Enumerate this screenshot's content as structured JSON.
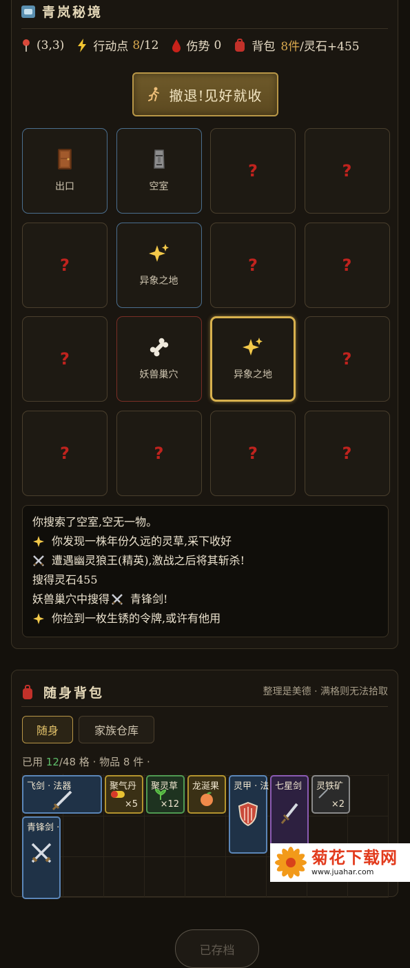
{
  "realm": {
    "title": "青岚秘境",
    "coords": "(3,3)",
    "action_label": "行动点",
    "action_value": "8",
    "action_max": "/12",
    "injury_label": "伤势",
    "injury_value": "0",
    "bag_label": "背包",
    "bag_items": "8件",
    "bag_stones": "/灵石+455",
    "retreat_button": "撤退!见好就收",
    "cells": [
      {
        "label": "出口",
        "type": "exit",
        "icon": "door-icon"
      },
      {
        "label": "空室",
        "type": "empty",
        "icon": "moai-icon"
      },
      {
        "label": "?",
        "type": "unknown",
        "icon": "question-mark-icon"
      },
      {
        "label": "?",
        "type": "unknown",
        "icon": "question-mark-icon"
      },
      {
        "label": "?",
        "type": "unknown",
        "icon": "question-mark-icon"
      },
      {
        "label": "异象之地",
        "type": "anomaly",
        "icon": "sparkles-icon"
      },
      {
        "label": "?",
        "type": "unknown",
        "icon": "question-mark-icon"
      },
      {
        "label": "?",
        "type": "unknown",
        "icon": "question-mark-icon"
      },
      {
        "label": "?",
        "type": "unknown",
        "icon": "question-mark-icon"
      },
      {
        "label": "妖兽巢穴",
        "type": "lair",
        "icon": "bone-icon"
      },
      {
        "label": "异象之地",
        "type": "current",
        "icon": "sparkles-icon"
      },
      {
        "label": "?",
        "type": "unknown",
        "icon": "question-mark-icon"
      },
      {
        "label": "?",
        "type": "unknown",
        "icon": "question-mark-icon"
      },
      {
        "label": "?",
        "type": "unknown",
        "icon": "question-mark-icon"
      },
      {
        "label": "?",
        "type": "unknown",
        "icon": "question-mark-icon"
      },
      {
        "label": "?",
        "type": "unknown",
        "icon": "question-mark-icon"
      }
    ],
    "log": [
      {
        "icon": "",
        "text": "你搜索了空室,空无一物。"
      },
      {
        "icon": "sparkles-icon",
        "text": "你发现一株年份久远的灵草,采下收好"
      },
      {
        "icon": "crossed-swords-icon",
        "text": "遭遇幽灵狼王(精英),激战之后将其斩杀!"
      },
      {
        "icon": "",
        "text": "搜得灵石455"
      },
      {
        "icon": "",
        "text": "妖兽巢穴中搜得",
        "icon_mid": "crossed-swords-icon",
        "text_after": "青锋剑!"
      },
      {
        "icon": "sparkles-icon",
        "text": "你捡到一枚生锈的令牌,或许有他用"
      }
    ]
  },
  "bag": {
    "title": "随身背包",
    "hint": "整理是美德 · 满格则无法拾取",
    "tabs": [
      "随身",
      "家族仓库"
    ],
    "usage_prefix": "已用",
    "usage_used": "12",
    "usage_total": "/48 格",
    "usage_items": "· 物品 8 件 ·",
    "items": [
      {
        "name": "飞剑 · 法器",
        "count": "",
        "icon": "sword-icon",
        "rarity": "blue"
      },
      {
        "name": "聚气丹",
        "count": "×5",
        "icon": "pill-icon",
        "rarity": "gold"
      },
      {
        "name": "聚灵草",
        "count": "×12",
        "icon": "herb-icon",
        "rarity": "green"
      },
      {
        "name": "龙涎果",
        "count": "",
        "icon": "peach-icon",
        "rarity": "gold"
      },
      {
        "name": "灵甲 · 法",
        "count": "",
        "icon": "shield-icon",
        "rarity": "blue"
      },
      {
        "name": "七星剑",
        "count": "",
        "icon": "dagger-icon",
        "rarity": "purple"
      },
      {
        "name": "灵铁矿",
        "count": "×2",
        "icon": "ore-icon",
        "rarity": "grey"
      },
      {
        "name": "青锋剑 ·",
        "count": "",
        "icon": "crossed-swords-icon",
        "rarity": "blue"
      }
    ],
    "save_button": "已存档"
  },
  "watermark": {
    "name": "菊花下载网",
    "url": "www.juahar.com"
  },
  "colors": {
    "background": "#14110c",
    "accent_gold": "#d8a84e",
    "unknown_red": "#c0231e",
    "current_border": "#d8b14e"
  }
}
